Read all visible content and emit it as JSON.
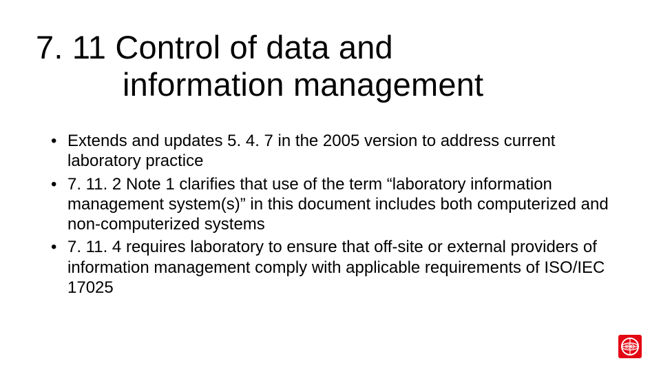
{
  "heading": {
    "number": "7. 11",
    "title_line1": "Control of data and",
    "title_line2": "information management"
  },
  "bullets": [
    "Extends and updates 5. 4. 7 in the 2005 version to address current laboratory practice",
    "7. 11. 2 Note 1 clarifies that use of the term “laboratory information management system(s)” in this document includes both computerized and non-computerized systems",
    "7. 11. 4 requires laboratory to ensure that off-site or external providers of information management comply with applicable requirements of ISO/IEC 17025"
  ],
  "logo": {
    "name": "ISO",
    "color": "#e30613"
  }
}
